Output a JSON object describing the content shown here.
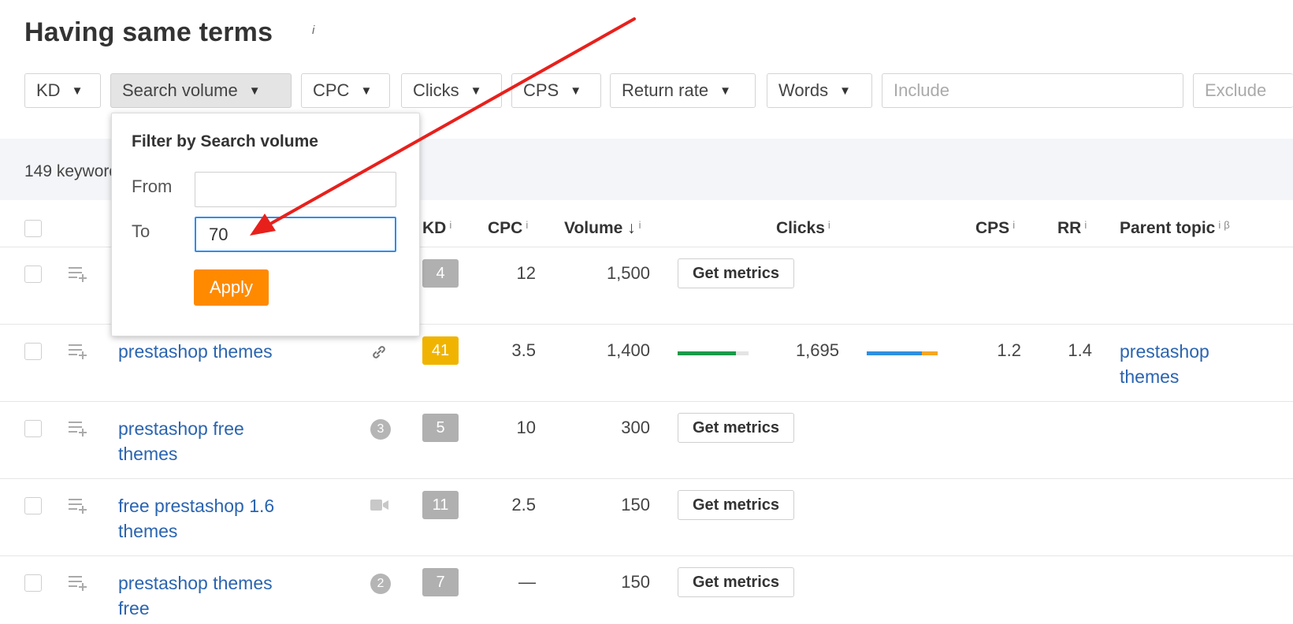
{
  "page": {
    "title": "Having same terms",
    "title_info": "i"
  },
  "filters": {
    "kd": "KD",
    "search_volume": "Search volume",
    "cpc": "CPC",
    "clicks": "Clicks",
    "cps": "CPS",
    "return_rate": "Return rate",
    "words": "Words",
    "include_placeholder": "Include",
    "exclude_placeholder": "Exclude",
    "caret": "▼"
  },
  "summary": {
    "text": "149 keywords"
  },
  "dropdown": {
    "title": "Filter by Search volume",
    "from_label": "From",
    "from_value": "",
    "to_label": "To",
    "to_value": "70",
    "apply_label": "Apply"
  },
  "table": {
    "headers": {
      "kd": "KD",
      "cpc": "CPC",
      "volume": "Volume",
      "volume_sort": "↓",
      "clicks": "Clicks",
      "cps": "CPS",
      "rr": "RR",
      "parent_topic": "Parent topic",
      "info": "i",
      "beta": "β"
    },
    "rows": [
      {
        "keyword": "",
        "serp": "",
        "kd": "4",
        "kd_color": "#b0b0b0",
        "cpc": "12",
        "volume": "1,500",
        "get_metrics": "Get metrics"
      },
      {
        "keyword": "prestashop themes",
        "serp": "link-icon",
        "kd": "41",
        "kd_color": "#f0b400",
        "cpc": "3.5",
        "volume": "1,400",
        "clicks_bar_fraction": 0.82,
        "clicks": "1,695",
        "cps_bar_fraction_organic": 0.78,
        "cps": "1.2",
        "rr": "1.4",
        "parent_topic": "prestashop themes"
      },
      {
        "keyword": "prestashop free themes",
        "serp": "3",
        "kd": "5",
        "kd_color": "#b0b0b0",
        "cpc": "10",
        "volume": "300",
        "get_metrics": "Get metrics"
      },
      {
        "keyword": "free prestashop 1.6 themes",
        "serp": "video-icon",
        "kd": "11",
        "kd_color": "#b0b0b0",
        "cpc": "2.5",
        "volume": "150",
        "get_metrics": "Get metrics"
      },
      {
        "keyword": "prestashop themes free",
        "serp": "2",
        "kd": "7",
        "kd_color": "#b0b0b0",
        "cpc": "—",
        "volume": "150",
        "get_metrics": "Get metrics"
      }
    ]
  },
  "colors": {
    "accent_orange": "#ff8a00",
    "link_blue": "#2a64b0",
    "focus_blue": "#2a8ef0",
    "arrow_red": "#e8201c",
    "bar_green": "#1a9a4a",
    "bar_blue": "#2f8fe0",
    "bar_orange": "#f5a623"
  }
}
